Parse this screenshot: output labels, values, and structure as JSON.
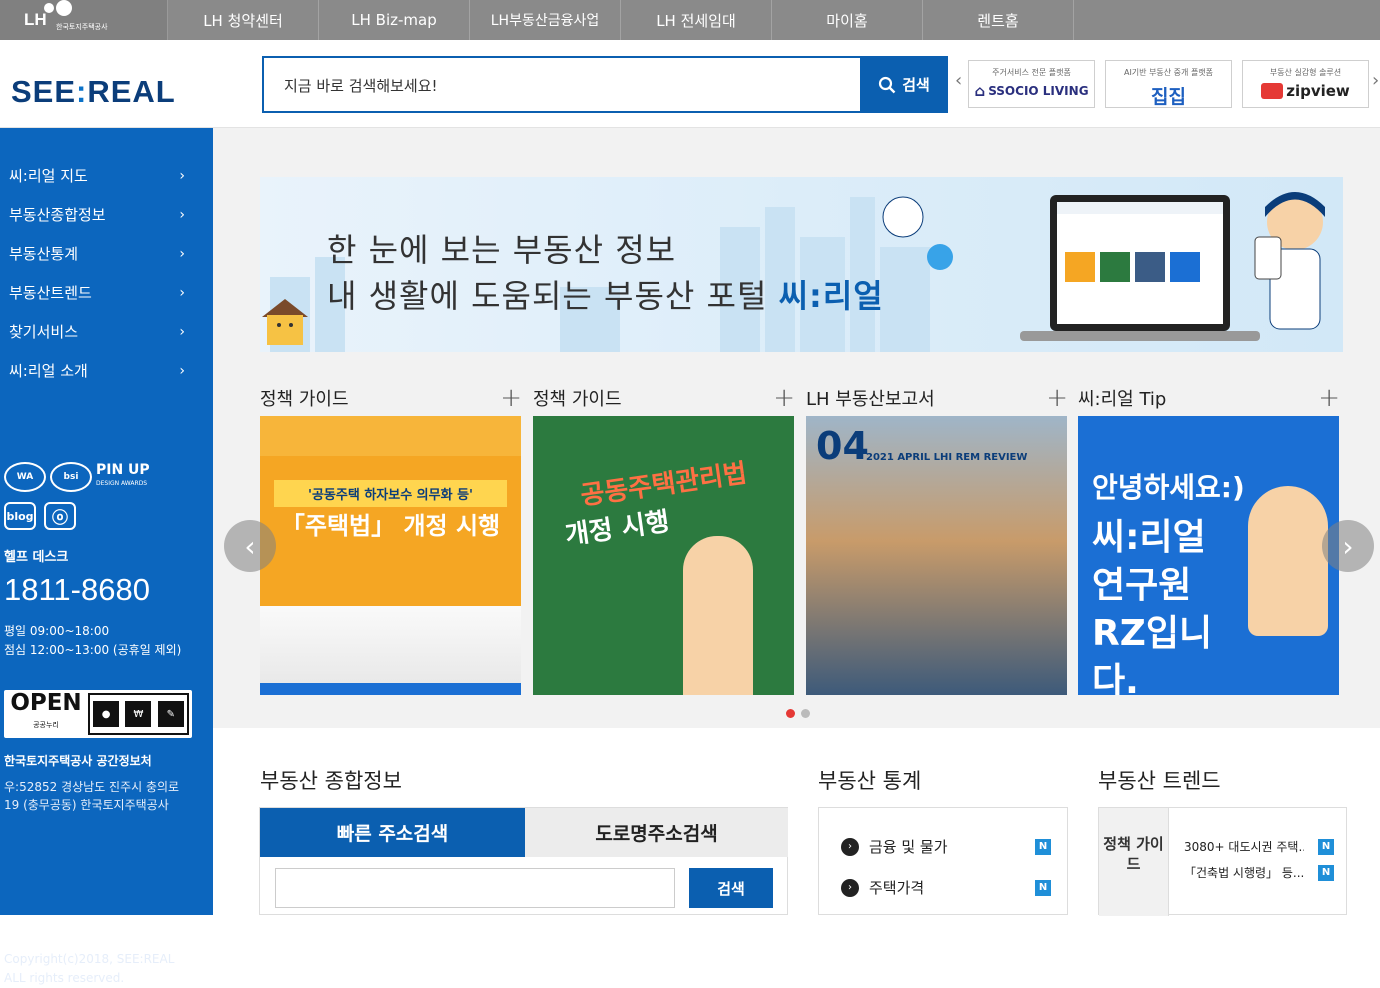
{
  "topbar": {
    "logo_mark": "LH",
    "logo_org": "한국토지주택공사",
    "items": [
      "LH 청약센터",
      "LH Biz-map",
      "LH부동산금융사업",
      "LH 전세임대",
      "마이홈",
      "렌트홈"
    ]
  },
  "header": {
    "brand_left": "SEE",
    "brand_colon": ":",
    "brand_right": "REAL",
    "search_placeholder": "지금 바로 검색해보세요!",
    "search_button": "검색",
    "partners": [
      {
        "caption": "주거서비스 전문 플랫폼",
        "name": "SSOCIO LIVING"
      },
      {
        "caption": "AI기반 부동산 중개 플랫폼",
        "name": "집집"
      },
      {
        "caption": "부동산 실감형 솔루션",
        "name": "zipview"
      }
    ]
  },
  "sidebar": {
    "menu": [
      "씨:리얼 지도",
      "부동산종합정보",
      "부동산통계",
      "부동산트렌드",
      "찾기서비스",
      "씨:리얼 소개"
    ],
    "certs": [
      "WA",
      "bsi"
    ],
    "pinup": "PIN UP",
    "pinup_sub": "DESIGN AWARDS",
    "socials": [
      "blog",
      "ⓞ"
    ],
    "help_title": "헬프 데스크",
    "phone": "1811-8680",
    "hours_weekday": "평일 09:00~18:00",
    "hours_lunch": "점심 12:00~13:00 (공휴일 제외)",
    "open_label": "OPEN",
    "open_sub": "공공누리",
    "addr_title": "한국토지주택공사 공간정보처",
    "addr_line1": "우:52852 경상남도 진주시 충의로",
    "addr_line2": "19 (충무공동) 한국토지주택공사",
    "copy_line1": "Copyright(c)2018, SEE:REAL",
    "copy_line2": "ALL rights reserved."
  },
  "banner": {
    "line1": "한 눈에 보는 부동산 정보",
    "line2_prefix": "내 생활에 도움되는 부동산 포털 ",
    "line2_accent": "씨:리얼"
  },
  "cards": [
    {
      "label": "정책 가이드",
      "t1": "'공동주택 하자보수 의무화 등'",
      "t2": "「주택법」 개정 시행"
    },
    {
      "label": "정책 가이드",
      "t1": "공동주택관리법",
      "t2": "개정 시행"
    },
    {
      "label": "LH 부동산보고서",
      "t1": "04",
      "t2": "2021 APRIL LHI REM REVIEW"
    },
    {
      "label": "씨:리얼 Tip",
      "t1": "안녕하세요:)",
      "t2": "씨:리얼 연구원 RZ입니다."
    }
  ],
  "sections": {
    "info_title": "부동산 종합정보",
    "tab_quick": "빠른 주소검색",
    "tab_road": "도로명주소검색",
    "addr_search_button": "검색",
    "stats_title": "부동산 통계",
    "stats": [
      "금융 및 물가",
      "주택가격"
    ],
    "trend_title": "부동산 트렌드",
    "trend_label": "정책 가이드",
    "trends": [
      "3080+ 대도시권 주택...",
      "「건축법 시행령」 등..."
    ],
    "new_badge": "N"
  },
  "colors": {
    "primary": "#0b5fb0",
    "sidebar": "#0c66be",
    "topbar": "#8a8a8a",
    "dot_active": "#e53935"
  }
}
